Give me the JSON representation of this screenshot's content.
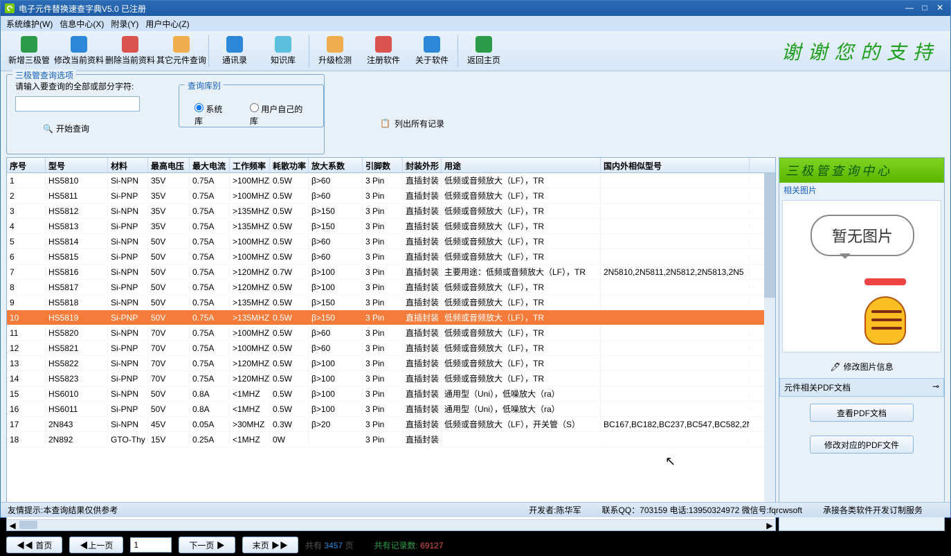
{
  "title": "电子元件替换速查字典V5.0 已注册",
  "menus": [
    "系统维护(W)",
    "信息中心(X)",
    "附录(Y)",
    "用户中心(Z)"
  ],
  "toolbar": [
    {
      "label": "新增三极管",
      "icon": "#2b9b4a"
    },
    {
      "label": "修改当前资料",
      "icon": "#2b88d8"
    },
    {
      "label": "删除当前资料",
      "icon": "#d9534f"
    },
    {
      "label": "其它元件查询",
      "icon": "#f0ad4e"
    },
    {
      "label": "通讯录",
      "icon": "#2b88d8"
    },
    {
      "label": "知识库",
      "icon": "#5bc0de"
    },
    {
      "label": "升级检测",
      "icon": "#f0ad4e"
    },
    {
      "label": "注册软件",
      "icon": "#d9534f"
    },
    {
      "label": "关于软件",
      "icon": "#2b88d8"
    },
    {
      "label": "返回主页",
      "icon": "#2b9b4a"
    }
  ],
  "banner": "谢谢您的支持",
  "query": {
    "legend": "三极管查询选项",
    "label": "请输入要查询的全部或部分字符:",
    "start": "开始查询",
    "dblegend": "查询库别",
    "radio1": "系统库",
    "radio2": "用户自己的库",
    "listall": "列出所有记录"
  },
  "columns": [
    "序号",
    "型号",
    "材料",
    "最高电压",
    "最大电流",
    "工作频率",
    "耗散功率",
    "放大系数",
    "引脚数",
    "封装外形",
    "用途",
    "国内外相似型号"
  ],
  "rows": [
    {
      "n": "1",
      "m": "HS5810",
      "t": "Si-NPN",
      "v": "35V",
      "i": "0.75A",
      "f": ">100MHZ",
      "p": "0.5W",
      "b": "β>60",
      "pin": "3 Pin",
      "pk": "直插封装",
      "u": "低频或音频放大（LF），TR",
      "s": ""
    },
    {
      "n": "2",
      "m": "HS5811",
      "t": "Si-PNP",
      "v": "35V",
      "i": "0.75A",
      "f": ">100MHZ",
      "p": "0.5W",
      "b": "β>60",
      "pin": "3 Pin",
      "pk": "直插封装",
      "u": "低频或音频放大（LF），TR",
      "s": ""
    },
    {
      "n": "3",
      "m": "HS5812",
      "t": "Si-NPN",
      "v": "35V",
      "i": "0.75A",
      "f": ">135MHZ",
      "p": "0.5W",
      "b": "β>150",
      "pin": "3 Pin",
      "pk": "直插封装",
      "u": "低频或音频放大（LF），TR",
      "s": ""
    },
    {
      "n": "4",
      "m": "HS5813",
      "t": "Si-PNP",
      "v": "35V",
      "i": "0.75A",
      "f": ">135MHZ",
      "p": "0.5W",
      "b": "β>150",
      "pin": "3 Pin",
      "pk": "直插封装",
      "u": "低频或音频放大（LF），TR",
      "s": ""
    },
    {
      "n": "5",
      "m": "HS5814",
      "t": "Si-NPN",
      "v": "50V",
      "i": "0.75A",
      "f": ">100MHZ",
      "p": "0.5W",
      "b": "β>60",
      "pin": "3 Pin",
      "pk": "直插封装",
      "u": "低频或音频放大（LF），TR",
      "s": ""
    },
    {
      "n": "6",
      "m": "HS5815",
      "t": "Si-PNP",
      "v": "50V",
      "i": "0.75A",
      "f": ">100MHZ",
      "p": "0.5W",
      "b": "β>60",
      "pin": "3 Pin",
      "pk": "直插封装",
      "u": "低频或音频放大（LF），TR",
      "s": ""
    },
    {
      "n": "7",
      "m": "HS5816",
      "t": "Si-NPN",
      "v": "50V",
      "i": "0.75A",
      "f": ">120MHZ",
      "p": "0.7W",
      "b": "β>100",
      "pin": "3 Pin",
      "pk": "直插封装",
      "u": "主要用途：低频或音频放大（LF），TR",
      "s": "2N5810,2N5811,2N5812,2N5813,2N5"
    },
    {
      "n": "8",
      "m": "HS5817",
      "t": "Si-PNP",
      "v": "50V",
      "i": "0.75A",
      "f": ">120MHZ",
      "p": "0.5W",
      "b": "β>100",
      "pin": "3 Pin",
      "pk": "直插封装",
      "u": "低频或音频放大（LF），TR",
      "s": ""
    },
    {
      "n": "9",
      "m": "HS5818",
      "t": "Si-NPN",
      "v": "50V",
      "i": "0.75A",
      "f": ">135MHZ",
      "p": "0.5W",
      "b": "β>150",
      "pin": "3 Pin",
      "pk": "直插封装",
      "u": "低频或音频放大（LF），TR",
      "s": ""
    },
    {
      "n": "10",
      "m": "HS5819",
      "t": "Si-PNP",
      "v": "50V",
      "i": "0.75A",
      "f": ">135MHZ",
      "p": "0.5W",
      "b": "β>150",
      "pin": "3 Pin",
      "pk": "直插封装",
      "u": "低频或音频放大（LF），TR",
      "s": "",
      "sel": true
    },
    {
      "n": "11",
      "m": "HS5820",
      "t": "Si-NPN",
      "v": "70V",
      "i": "0.75A",
      "f": ">100MHZ",
      "p": "0.5W",
      "b": "β>60",
      "pin": "3 Pin",
      "pk": "直插封装",
      "u": "低频或音频放大（LF），TR",
      "s": ""
    },
    {
      "n": "12",
      "m": "HS5821",
      "t": "Si-PNP",
      "v": "70V",
      "i": "0.75A",
      "f": ">100MHZ",
      "p": "0.5W",
      "b": "β>60",
      "pin": "3 Pin",
      "pk": "直插封装",
      "u": "低频或音频放大（LF），TR",
      "s": ""
    },
    {
      "n": "13",
      "m": "HS5822",
      "t": "Si-NPN",
      "v": "70V",
      "i": "0.75A",
      "f": ">120MHZ",
      "p": "0.5W",
      "b": "β>100",
      "pin": "3 Pin",
      "pk": "直插封装",
      "u": "低频或音频放大（LF），TR",
      "s": ""
    },
    {
      "n": "14",
      "m": "HS5823",
      "t": "Si-PNP",
      "v": "70V",
      "i": "0.75A",
      "f": ">120MHZ",
      "p": "0.5W",
      "b": "β>100",
      "pin": "3 Pin",
      "pk": "直插封装",
      "u": "低频或音频放大（LF），TR",
      "s": ""
    },
    {
      "n": "15",
      "m": "HS6010",
      "t": "Si-NPN",
      "v": "50V",
      "i": "0.8A",
      "f": "<1MHZ",
      "p": "0.5W",
      "b": "β>100",
      "pin": "3 Pin",
      "pk": "直插封装",
      "u": "通用型（Uni），低噪放大（ra）",
      "s": ""
    },
    {
      "n": "16",
      "m": "HS6011",
      "t": "Si-PNP",
      "v": "50V",
      "i": "0.8A",
      "f": "<1MHZ",
      "p": "0.5W",
      "b": "β>100",
      "pin": "3 Pin",
      "pk": "直插封装",
      "u": "通用型（Uni），低噪放大（ra）",
      "s": ""
    },
    {
      "n": "17",
      "m": "2N843",
      "t": "Si-NPN",
      "v": "45V",
      "i": "0.05A",
      "f": ">30MHZ",
      "p": "0.3W",
      "b": "β>20",
      "pin": "3 Pin",
      "pk": "直插封装",
      "u": "低频或音频放大（LF），开关管（S）",
      "s": "BC167,BC182,BC237,BC547,BC582,2N"
    },
    {
      "n": "18",
      "m": "2N892",
      "t": "GTO-Thy",
      "v": "15V",
      "i": "0.25A",
      "f": "<1MHZ",
      "p": "0W",
      "b": "",
      "pin": "3 Pin",
      "pk": "直插封装",
      "u": "",
      "s": ""
    }
  ],
  "pager": {
    "first": "◀◀ 首页",
    "prev": "◀上一页",
    "page": "1",
    "next": "下一页 ▶",
    "last": "末页 ▶▶",
    "total_label": "共有",
    "total_pages": "3457",
    "pages_unit": "页",
    "records_label": "共有记录数:",
    "records": "69127"
  },
  "side": {
    "title": "三极管查询中心",
    "imglabel": "相关图片",
    "noimg": "暂无图片",
    "editimg": "修改图片信息",
    "pdfhead": "元件相关PDF文档",
    "viewpdf": "查看PDF文档",
    "editpdf": "修改对应的PDF文件"
  },
  "status": {
    "tip": "友情提示:本查询结果仅供参考",
    "dev": "开发者:陈华军",
    "qq": "联系QQ：703159 电话:13950324972 微信号:fqrcwsoft",
    "svc": "承接各类软件开发订制服务"
  }
}
